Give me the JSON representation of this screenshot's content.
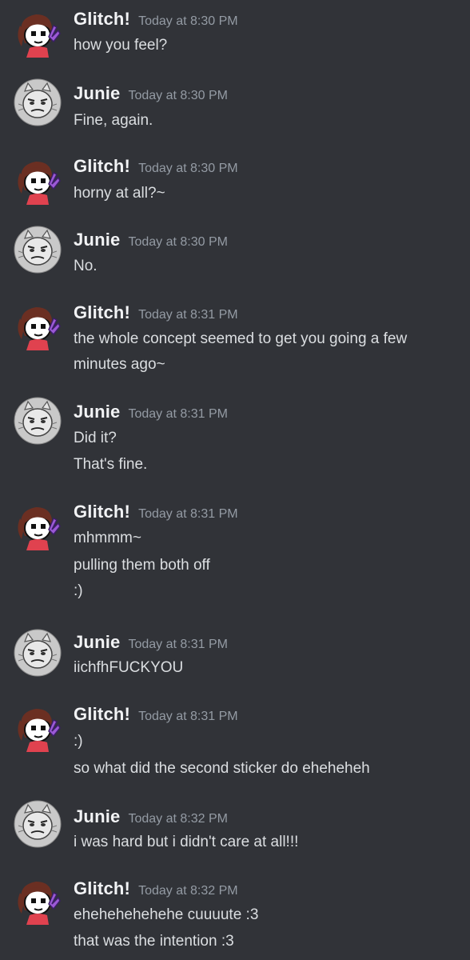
{
  "users": {
    "glitch": {
      "name": "Glitch!",
      "avatar_icon": "girl-peace-sign-avatar-icon"
    },
    "junie": {
      "name": "Junie",
      "avatar_icon": "gray-sketch-face-avatar-icon"
    }
  },
  "messages": [
    {
      "author": "Glitch!",
      "time": "Today at 8:30 PM",
      "lines": [
        "how you feel?"
      ]
    },
    {
      "author": "Junie",
      "time": "Today at 8:30 PM",
      "lines": [
        "Fine, again."
      ]
    },
    {
      "author": "Glitch!",
      "time": "Today at 8:30 PM",
      "lines": [
        "horny at all?~"
      ]
    },
    {
      "author": "Junie",
      "time": "Today at 8:30 PM",
      "lines": [
        "No."
      ]
    },
    {
      "author": "Glitch!",
      "time": "Today at 8:31 PM",
      "lines": [
        "the whole concept seemed to get you going a few",
        "minutes ago~"
      ]
    },
    {
      "author": "Junie",
      "time": "Today at 8:31 PM",
      "lines": [
        "Did it?",
        "That's fine."
      ]
    },
    {
      "author": "Glitch!",
      "time": "Today at 8:31 PM",
      "lines": [
        "mhmmm~",
        "pulling them both off",
        ":)"
      ]
    },
    {
      "author": "Junie",
      "time": "Today at 8:31 PM",
      "lines": [
        "iichfhFUCKYOU"
      ]
    },
    {
      "author": "Glitch!",
      "time": "Today at 8:31 PM",
      "lines": [
        ":)",
        "so what did the second sticker do eheheheh"
      ]
    },
    {
      "author": "Junie",
      "time": "Today at 8:32 PM",
      "lines": [
        "i was hard but i didn't care at all!!!"
      ]
    },
    {
      "author": "Glitch!",
      "time": "Today at 8:32 PM",
      "lines": [
        "ehehehehehehe cuuuute :3",
        "that was the intention :3"
      ]
    }
  ]
}
